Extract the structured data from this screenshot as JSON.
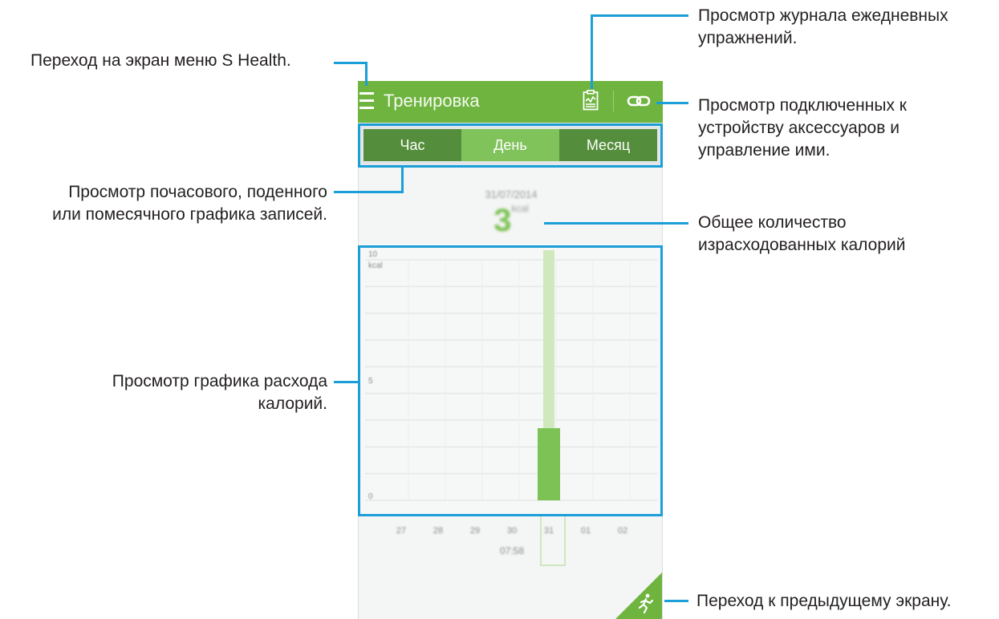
{
  "callouts": {
    "menu": "Переход на экран меню S Health.",
    "journal": [
      "Просмотр журнала ежедневных",
      "упражнений."
    ],
    "accessories": [
      "Просмотр подключенных к",
      "устройству аксессуаров и",
      "управление ими."
    ],
    "period": [
      "Просмотр почасового, поденного",
      "или помесячного графика записей."
    ],
    "total": [
      "Общее количество",
      "израсходованных калорий"
    ],
    "graph": [
      "Просмотр графика расхода",
      "калорий."
    ],
    "back": "Переход к предыдущему экрану."
  },
  "app": {
    "title": "Тренировка",
    "tabs": [
      "Час",
      "День",
      "Месяц"
    ],
    "active_tab": "День"
  },
  "summary": {
    "date": "31/07/2014",
    "value": "3",
    "unit": "kcal"
  },
  "chart_data": {
    "type": "bar",
    "categories": [
      "27",
      "28",
      "29",
      "30",
      "31",
      "01",
      "02"
    ],
    "values": [
      0,
      0,
      0,
      0,
      3,
      0,
      0
    ],
    "ylim": [
      0,
      10
    ],
    "y_ticks": [
      "0",
      "5",
      "10"
    ],
    "y_top_label": "10",
    "y_top_sublabel": "kcal",
    "selected_category": "31",
    "selected_time": "07:58",
    "bar_color": "#7cc254",
    "grid": true
  },
  "colors": {
    "appbar": "#6fb43f",
    "tab_inactive": "#4d8a33",
    "tab_active": "#7cc254",
    "callout_line": "#1a9fd8"
  },
  "icons": {
    "menu": "hamburger-icon",
    "journal": "journal-icon",
    "accessories": "link-icon",
    "back": "runner-icon"
  }
}
